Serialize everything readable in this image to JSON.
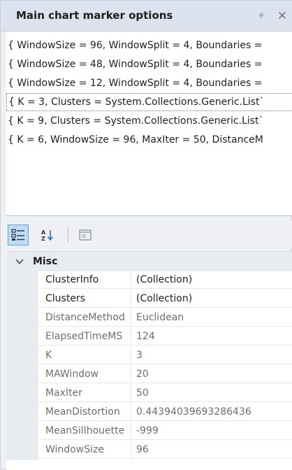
{
  "panel": {
    "title": "Main chart marker options",
    "pin_glyph": "⫩",
    "close_glyph": "✕"
  },
  "list": {
    "items": [
      "{ WindowSize = 96, WindowSplit = 4, Boundaries = ",
      "{ WindowSize = 48, WindowSplit = 4, Boundaries = ",
      "{ WindowSize = 12, WindowSplit = 4, Boundaries = ",
      "{ K = 3, Clusters = System.Collections.Generic.List`",
      "{ K = 9, Clusters = System.Collections.Generic.List`",
      "{ K = 6, WindowSize = 96, MaxIter = 50, DistanceM"
    ],
    "selected_index": 3
  },
  "toolbar": {
    "categorized_icon": "categorized-view-icon",
    "alphabetical_icon": "alphabetical-sort-icon",
    "pages_icon": "property-pages-icon"
  },
  "properties": {
    "category": "Misc",
    "rows": [
      {
        "name": "ClusterInfo",
        "value": "(Collection)",
        "editable": true
      },
      {
        "name": "Clusters",
        "value": "(Collection)",
        "editable": true
      },
      {
        "name": "DistanceMethod",
        "value": "Euclidean",
        "editable": false
      },
      {
        "name": "ElapsedTimeMS",
        "value": "124",
        "editable": false
      },
      {
        "name": "K",
        "value": "3",
        "editable": false
      },
      {
        "name": "MAWindow",
        "value": "20",
        "editable": false
      },
      {
        "name": "MaxIter",
        "value": "50",
        "editable": false
      },
      {
        "name": "MeanDistortion",
        "value": "0.44394039693286436",
        "editable": false
      },
      {
        "name": "MeanSillhouette",
        "value": "-999",
        "editable": false
      },
      {
        "name": "WindowSize",
        "value": "96",
        "editable": false
      }
    ]
  },
  "colors": {
    "selected_tool_bg": "#bcdcf7",
    "selected_tool_border": "#5ca5e6",
    "readonly_text": "#6d6d6d"
  }
}
